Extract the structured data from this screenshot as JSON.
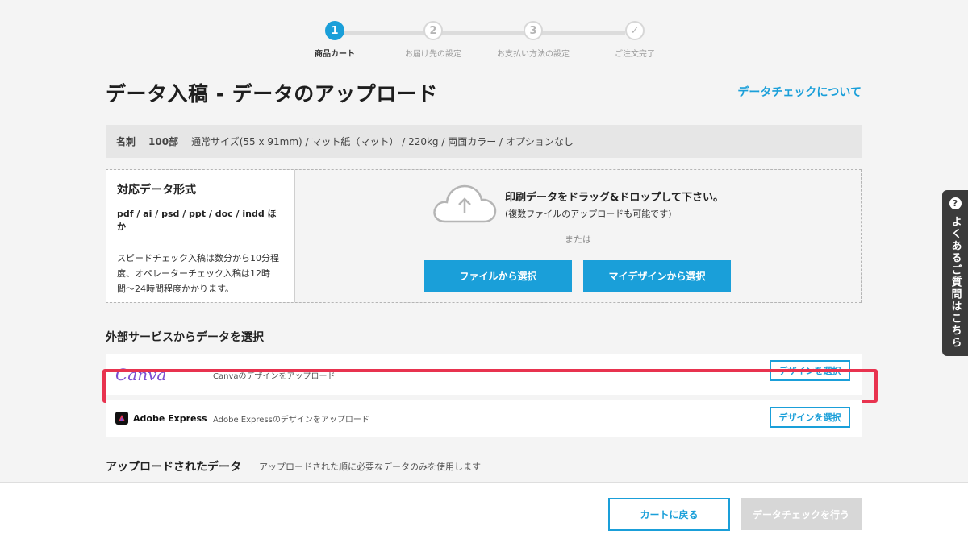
{
  "stepper": {
    "steps": [
      {
        "number": "1",
        "label": "商品カート"
      },
      {
        "number": "2",
        "label": "お届け先の設定"
      },
      {
        "number": "3",
        "label": "お支払い方法の設定"
      },
      {
        "number": "✓",
        "label": "ご注文完了"
      }
    ]
  },
  "header": {
    "title": "データ入稿 - データのアップロード",
    "about_link": "データチェックについて"
  },
  "summary": {
    "product": "名刺",
    "quantity": "100部",
    "spec": "通常サイズ(55 x 91mm) / マット紙（マット） / 220kg / 両面カラー / オプションなし"
  },
  "formats": {
    "title": "対応データ形式",
    "list": "pdf / ai / psd / ppt / doc / indd ほか",
    "description": "スピードチェック入稿は数分から10分程度、オペレーターチェック入稿は12時間〜24時間程度かかります。"
  },
  "drop": {
    "main": "印刷データをドラッグ&ドロップして下さい。",
    "sub": "(複数ファイルのアップロードも可能です)",
    "or": "または",
    "file_button": "ファイルから選択",
    "design_button": "マイデザインから選択"
  },
  "external": {
    "title": "外部サービスからデータを選択",
    "services": [
      {
        "logo_text": "Canva",
        "description": "Canvaのデザインをアップロード",
        "button": "デザインを選択"
      },
      {
        "logo_text": "Adobe Express",
        "description": "Adobe Expressのデザインをアップロード",
        "button": "デザインを選択"
      }
    ]
  },
  "uploaded": {
    "title": "アップロードされたデータ",
    "note": "アップロードされた順に必要なデータのみを使用します"
  },
  "footer": {
    "back_button": "カートに戻る",
    "check_button": "データチェックを行う"
  },
  "faq": {
    "icon": "?",
    "label": "よくあるご質問はこちら"
  },
  "colors": {
    "accent": "#1a9fd9",
    "highlight": "#e8334f",
    "disabled": "#d7d7d7"
  }
}
